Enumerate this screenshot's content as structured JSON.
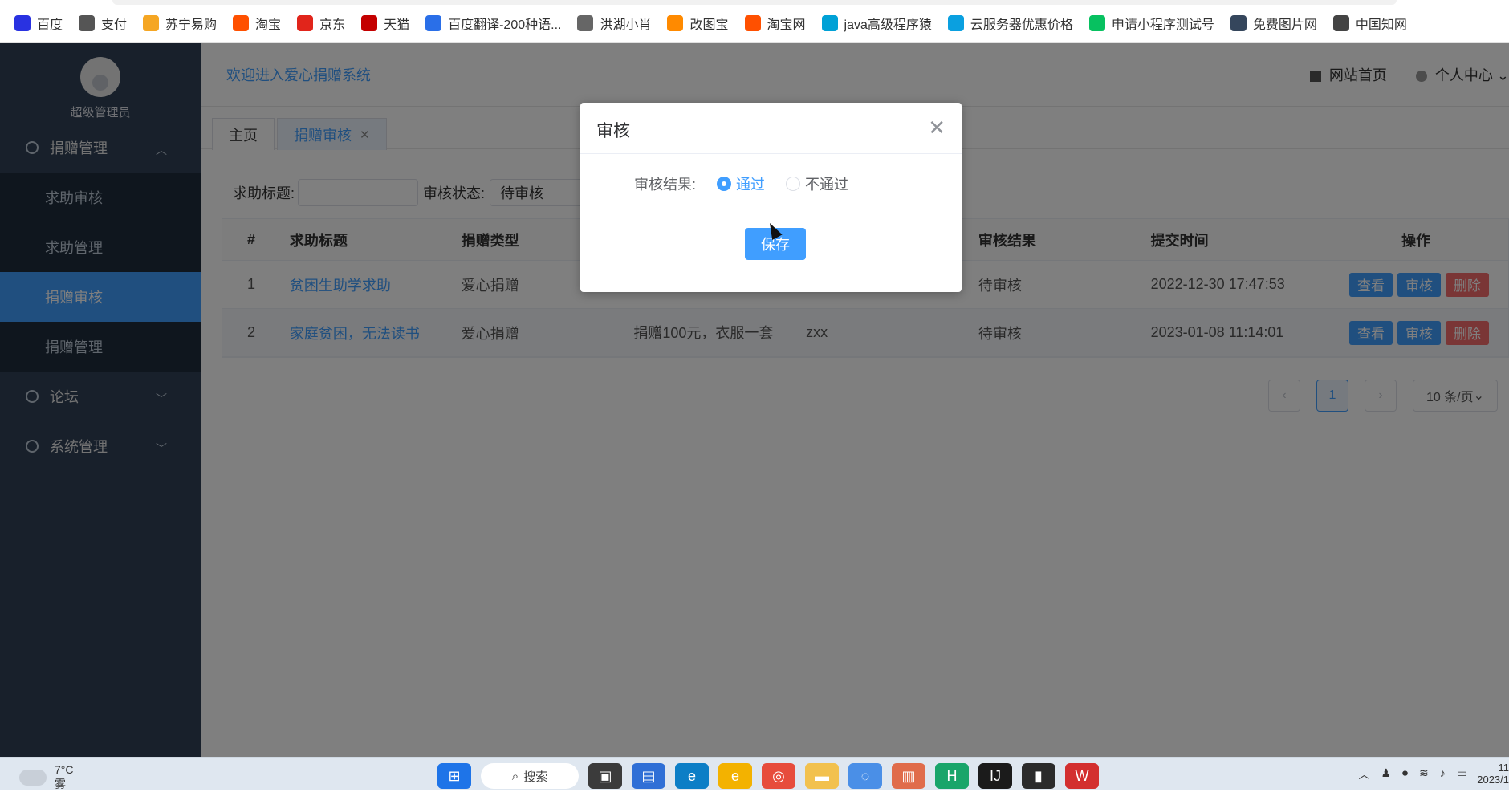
{
  "bookmarks": [
    {
      "label": "百度",
      "icon": "baidu-icon",
      "color": "#2932e1"
    },
    {
      "label": "支付",
      "icon": "globe-icon",
      "color": "#555555"
    },
    {
      "label": "苏宁易购",
      "icon": "suning-icon",
      "color": "#f5a623"
    },
    {
      "label": "淘宝",
      "icon": "taobao-icon",
      "color": "#ff5000"
    },
    {
      "label": "京东",
      "icon": "jd-icon",
      "color": "#e1251b"
    },
    {
      "label": "天猫",
      "icon": "tmall-icon",
      "color": "#c40000"
    },
    {
      "label": "百度翻译-200种语...",
      "icon": "translate-icon",
      "color": "#2a6fe8"
    },
    {
      "label": "洪湖小肖",
      "icon": "bird-icon",
      "color": "#666666"
    },
    {
      "label": "改图宝",
      "icon": "gaitubao-icon",
      "color": "#ff8a00"
    },
    {
      "label": "淘宝网",
      "icon": "taobao-icon",
      "color": "#ff5000"
    },
    {
      "label": "java高级程序猿",
      "icon": "bilibili-icon",
      "color": "#00a1d6"
    },
    {
      "label": "云服务器优惠价格",
      "icon": "cloud-icon",
      "color": "#0aa0e0"
    },
    {
      "label": "申请小程序测试号",
      "icon": "wechat-icon",
      "color": "#07c160"
    },
    {
      "label": "免费图片网",
      "icon": "tumblr-icon",
      "color": "#35465c"
    },
    {
      "label": "中国知网",
      "icon": "cnki-icon",
      "color": "#444444"
    }
  ],
  "sidebar": {
    "role": "超级管理员",
    "groups": [
      {
        "label": "捐赠管理",
        "expanded": true,
        "items": [
          "求助审核",
          "求助管理",
          "捐赠审核",
          "捐赠管理"
        ],
        "active_index": 2
      },
      {
        "label": "论坛",
        "expanded": false
      },
      {
        "label": "系统管理",
        "expanded": false
      }
    ]
  },
  "header": {
    "welcome": "欢迎进入爱心捐赠系统",
    "home_link": "网站首页",
    "profile": "个人中心"
  },
  "tabs": [
    {
      "label": "主页"
    },
    {
      "label": "捐赠审核",
      "closable": true
    }
  ],
  "search": {
    "title_label": "求助标题:",
    "status_label": "审核状态:",
    "status_value": "待审核"
  },
  "table": {
    "columns": [
      "#",
      "求助标题",
      "捐赠类型",
      "",
      "",
      "审核结果",
      "提交时间",
      "操作"
    ],
    "rows": [
      {
        "index": "1",
        "title": "贫困生助学求助",
        "type": "爱心捐赠",
        "content": "",
        "user": "",
        "result": "待审核",
        "time": "2022-12-30 17:47:53"
      },
      {
        "index": "2",
        "title": "家庭贫困，无法读书",
        "type": "爱心捐赠",
        "content": "捐赠100元，衣服一套",
        "user": "zxx",
        "result": "待审核",
        "time": "2023-01-08 11:14:01"
      }
    ],
    "actions": {
      "view": "查看",
      "audit": "审核",
      "delete": "删除"
    }
  },
  "pager": {
    "current": "1",
    "page_size": "10 条/页"
  },
  "dialog": {
    "title": "审核",
    "field_label": "审核结果:",
    "options": [
      "通过",
      "不通过"
    ],
    "selected": "通过",
    "save": "保存"
  },
  "taskbar": {
    "temperature": "7°C",
    "weather": "雾",
    "search": "搜索",
    "clock_time": "11",
    "clock_date": "2023/1"
  },
  "colors": {
    "primary": "#409eff",
    "danger": "#f56c6c",
    "sidebar": "#304156",
    "submenu": "#1f2d3d"
  }
}
